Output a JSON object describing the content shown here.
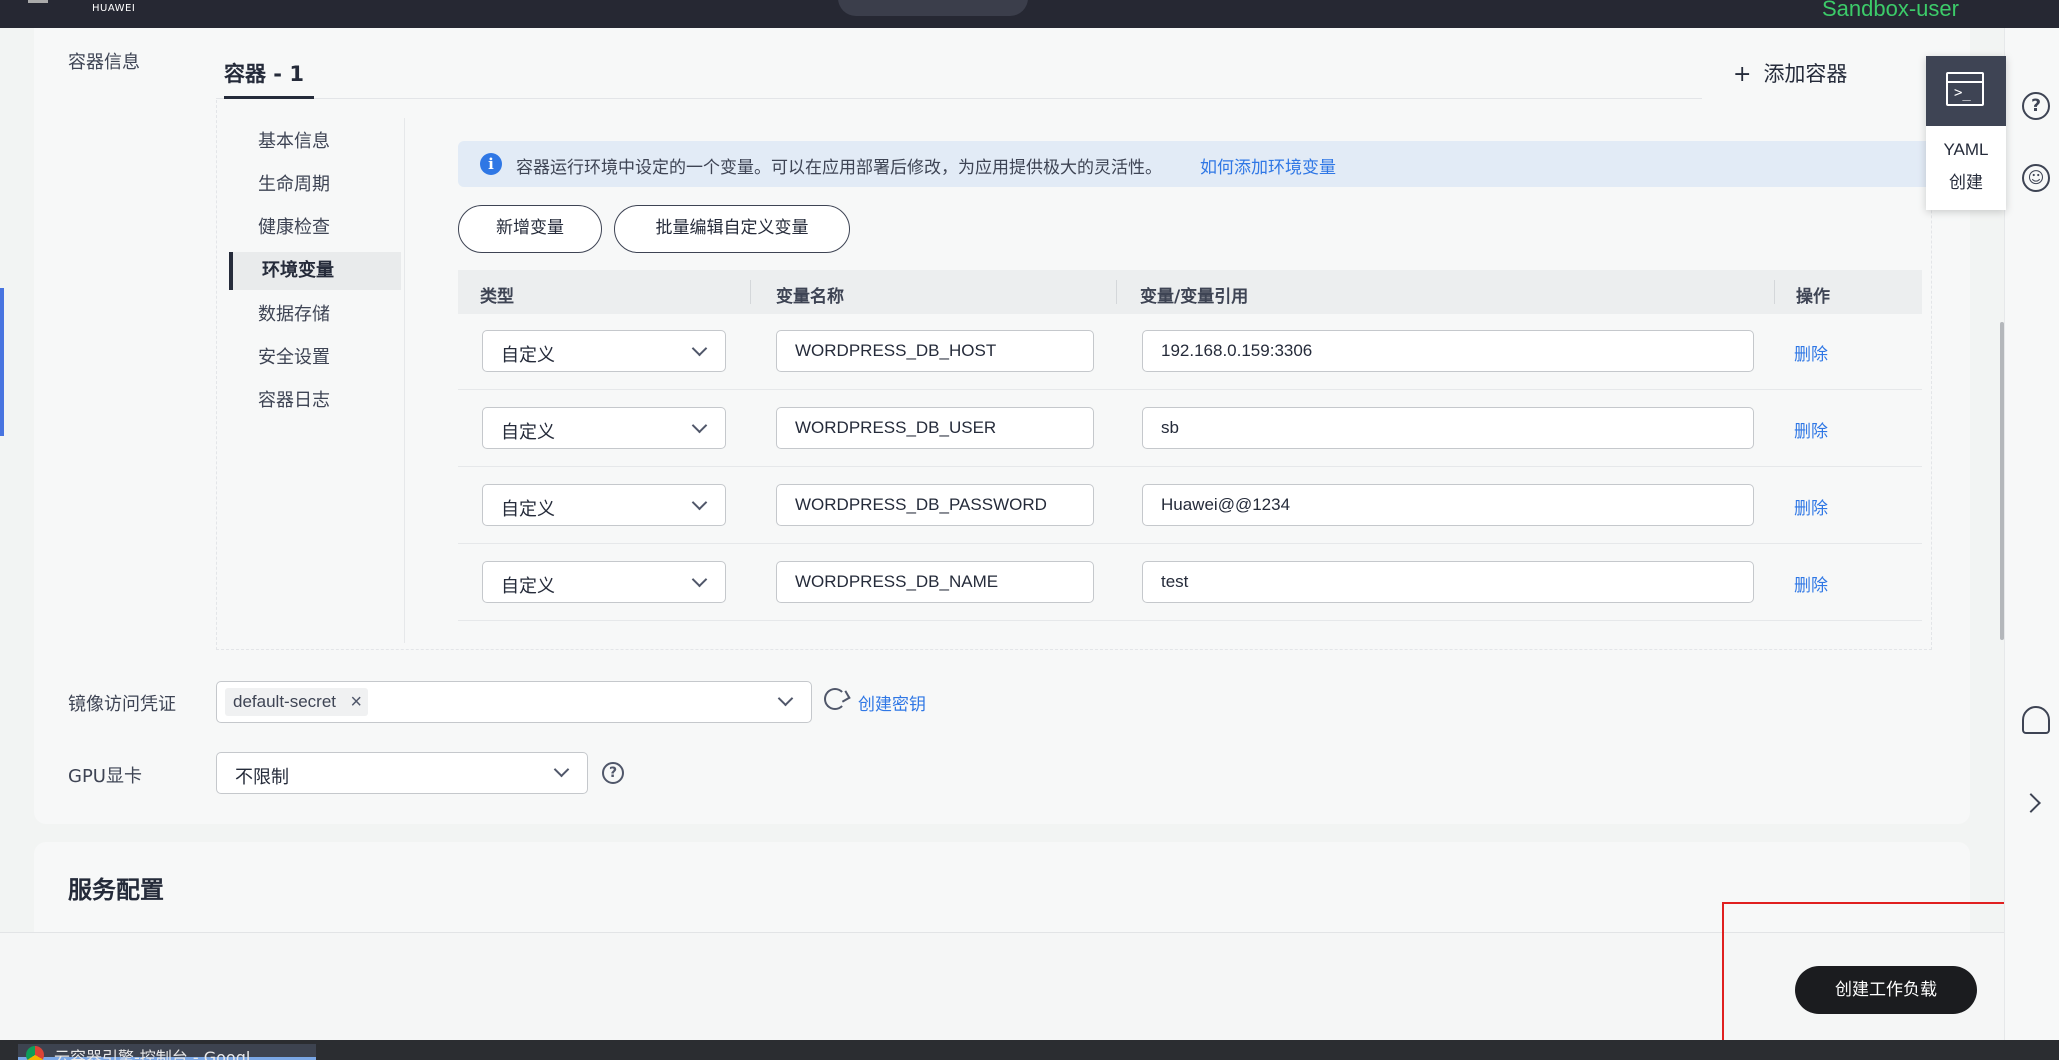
{
  "header": {
    "brand": "HUAWEI",
    "user": "Sandbox-user"
  },
  "container_info": {
    "label": "容器信息",
    "tab": "容器 - 1",
    "add_container": "添加容器"
  },
  "side_nav": {
    "items": [
      {
        "label": "基本信息",
        "active": false
      },
      {
        "label": "生命周期",
        "active": false
      },
      {
        "label": "健康检查",
        "active": false
      },
      {
        "label": "环境变量",
        "active": true
      },
      {
        "label": "数据存储",
        "active": false
      },
      {
        "label": "安全设置",
        "active": false
      },
      {
        "label": "容器日志",
        "active": false
      }
    ]
  },
  "env": {
    "info_text": "容器运行环境中设定的一个变量。可以在应用部署后修改，为应用提供极大的灵活性。",
    "info_link": "如何添加环境变量",
    "add_button": "新增变量",
    "batch_button": "批量编辑自定义变量",
    "columns": [
      "类型",
      "变量名称",
      "变量/变量引用",
      "操作"
    ],
    "rows": [
      {
        "type": "自定义",
        "name": "WORDPRESS_DB_HOST",
        "value": "192.168.0.159:3306",
        "action": "删除"
      },
      {
        "type": "自定义",
        "name": "WORDPRESS_DB_USER",
        "value": "sb",
        "action": "删除"
      },
      {
        "type": "自定义",
        "name": "WORDPRESS_DB_PASSWORD",
        "value": "Huawei@@1234",
        "action": "删除"
      },
      {
        "type": "自定义",
        "name": "WORDPRESS_DB_NAME",
        "value": "test",
        "action": "删除"
      }
    ]
  },
  "image_secret": {
    "label": "镜像访问凭证",
    "tag": "default-secret",
    "create_link": "创建密钥"
  },
  "gpu": {
    "label": "GPU显卡",
    "value": "不限制"
  },
  "service": {
    "title": "服务配置"
  },
  "footer": {
    "create_button": "创建工作负载"
  },
  "yaml": {
    "line1": "YAML",
    "line2": "创建"
  },
  "taskbar": {
    "item": "云容器引擎-控制台 - Googl…"
  }
}
